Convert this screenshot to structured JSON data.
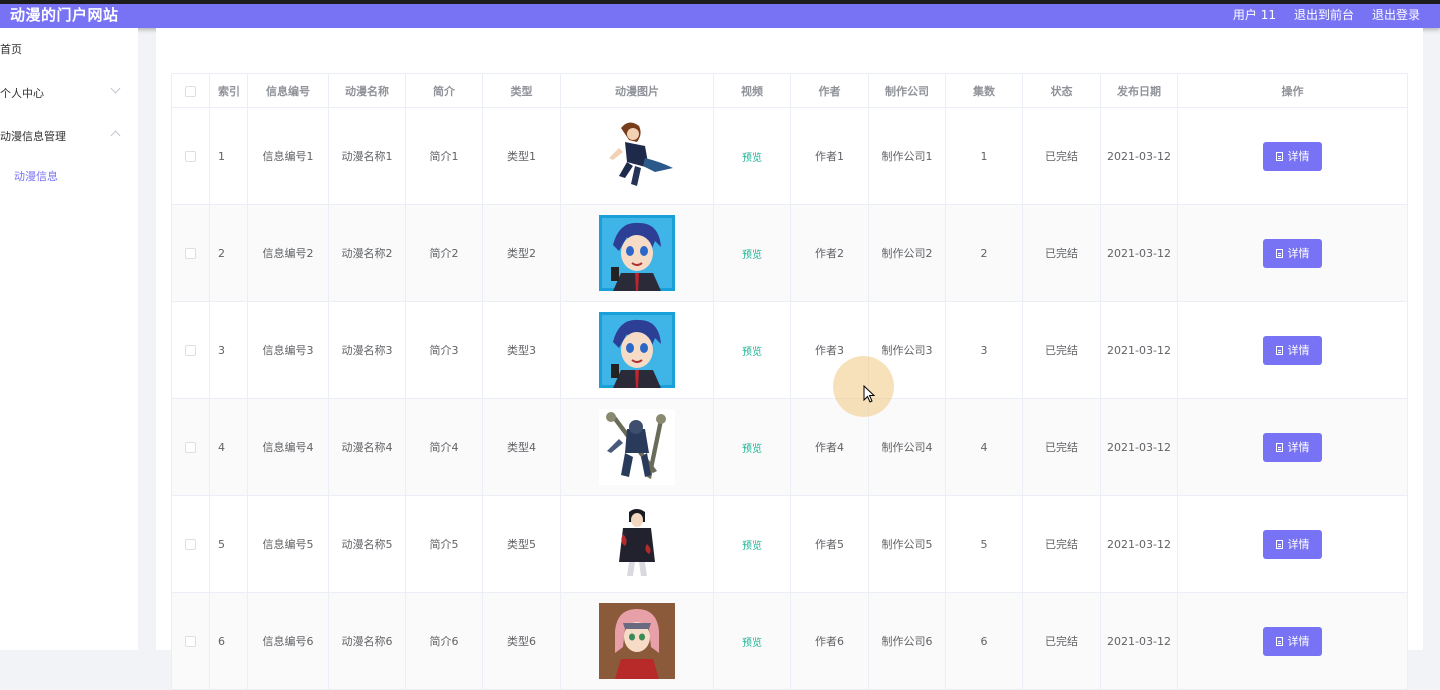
{
  "header": {
    "title": "动漫的门户网站",
    "user": "用户 11",
    "to_front": "退出到前台",
    "logout": "退出登录"
  },
  "sidebar": {
    "home": "首页",
    "personal": "个人中心",
    "anime_mgmt": "动漫信息管理",
    "anime_info": "动漫信息"
  },
  "table": {
    "headers": {
      "index": "索引",
      "code": "信息编号",
      "name": "动漫名称",
      "intro": "简介",
      "type": "类型",
      "image": "动漫图片",
      "video": "视频",
      "author": "作者",
      "company": "制作公司",
      "episodes": "集数",
      "status": "状态",
      "date": "发布日期",
      "action": "操作"
    },
    "rows": [
      {
        "index": "1",
        "code": "信息编号1",
        "name": "动漫名称1",
        "intro": "简介1",
        "type": "类型1",
        "video": "预览",
        "author": "作者1",
        "company": "制作公司1",
        "episodes": "1",
        "status": "已完结",
        "date": "2021-03-12",
        "action": "详情",
        "image_icon": "anime-character-woman-icon"
      },
      {
        "index": "2",
        "code": "信息编号2",
        "name": "动漫名称2",
        "intro": "简介2",
        "type": "类型2",
        "video": "预览",
        "author": "作者2",
        "company": "制作公司2",
        "episodes": "2",
        "status": "已完结",
        "date": "2021-03-12",
        "action": "详情",
        "image_icon": "anime-boy-card-icon"
      },
      {
        "index": "3",
        "code": "信息编号3",
        "name": "动漫名称3",
        "intro": "简介3",
        "type": "类型3",
        "video": "预览",
        "author": "作者3",
        "company": "制作公司3",
        "episodes": "3",
        "status": "已完结",
        "date": "2021-03-12",
        "action": "详情",
        "image_icon": "anime-boy-card-icon"
      },
      {
        "index": "4",
        "code": "信息编号4",
        "name": "动漫名称4",
        "intro": "简介4",
        "type": "类型4",
        "video": "预览",
        "author": "作者4",
        "company": "制作公司4",
        "episodes": "4",
        "status": "已完结",
        "date": "2021-03-12",
        "action": "详情",
        "image_icon": "armored-warrior-icon"
      },
      {
        "index": "5",
        "code": "信息编号5",
        "name": "动漫名称5",
        "intro": "简介5",
        "type": "类型5",
        "video": "预览",
        "author": "作者5",
        "company": "制作公司5",
        "episodes": "5",
        "status": "已完结",
        "date": "2021-03-12",
        "action": "详情",
        "image_icon": "cloaked-ninja-icon"
      },
      {
        "index": "6",
        "code": "信息编号6",
        "name": "动漫名称6",
        "intro": "简介6",
        "type": "类型6",
        "video": "预览",
        "author": "作者6",
        "company": "制作公司6",
        "episodes": "6",
        "status": "已完结",
        "date": "2021-03-12",
        "action": "详情",
        "image_icon": "pink-hair-girl-icon"
      }
    ]
  },
  "colors": {
    "accent": "#7773f4",
    "preview_link": "#1bb394"
  }
}
